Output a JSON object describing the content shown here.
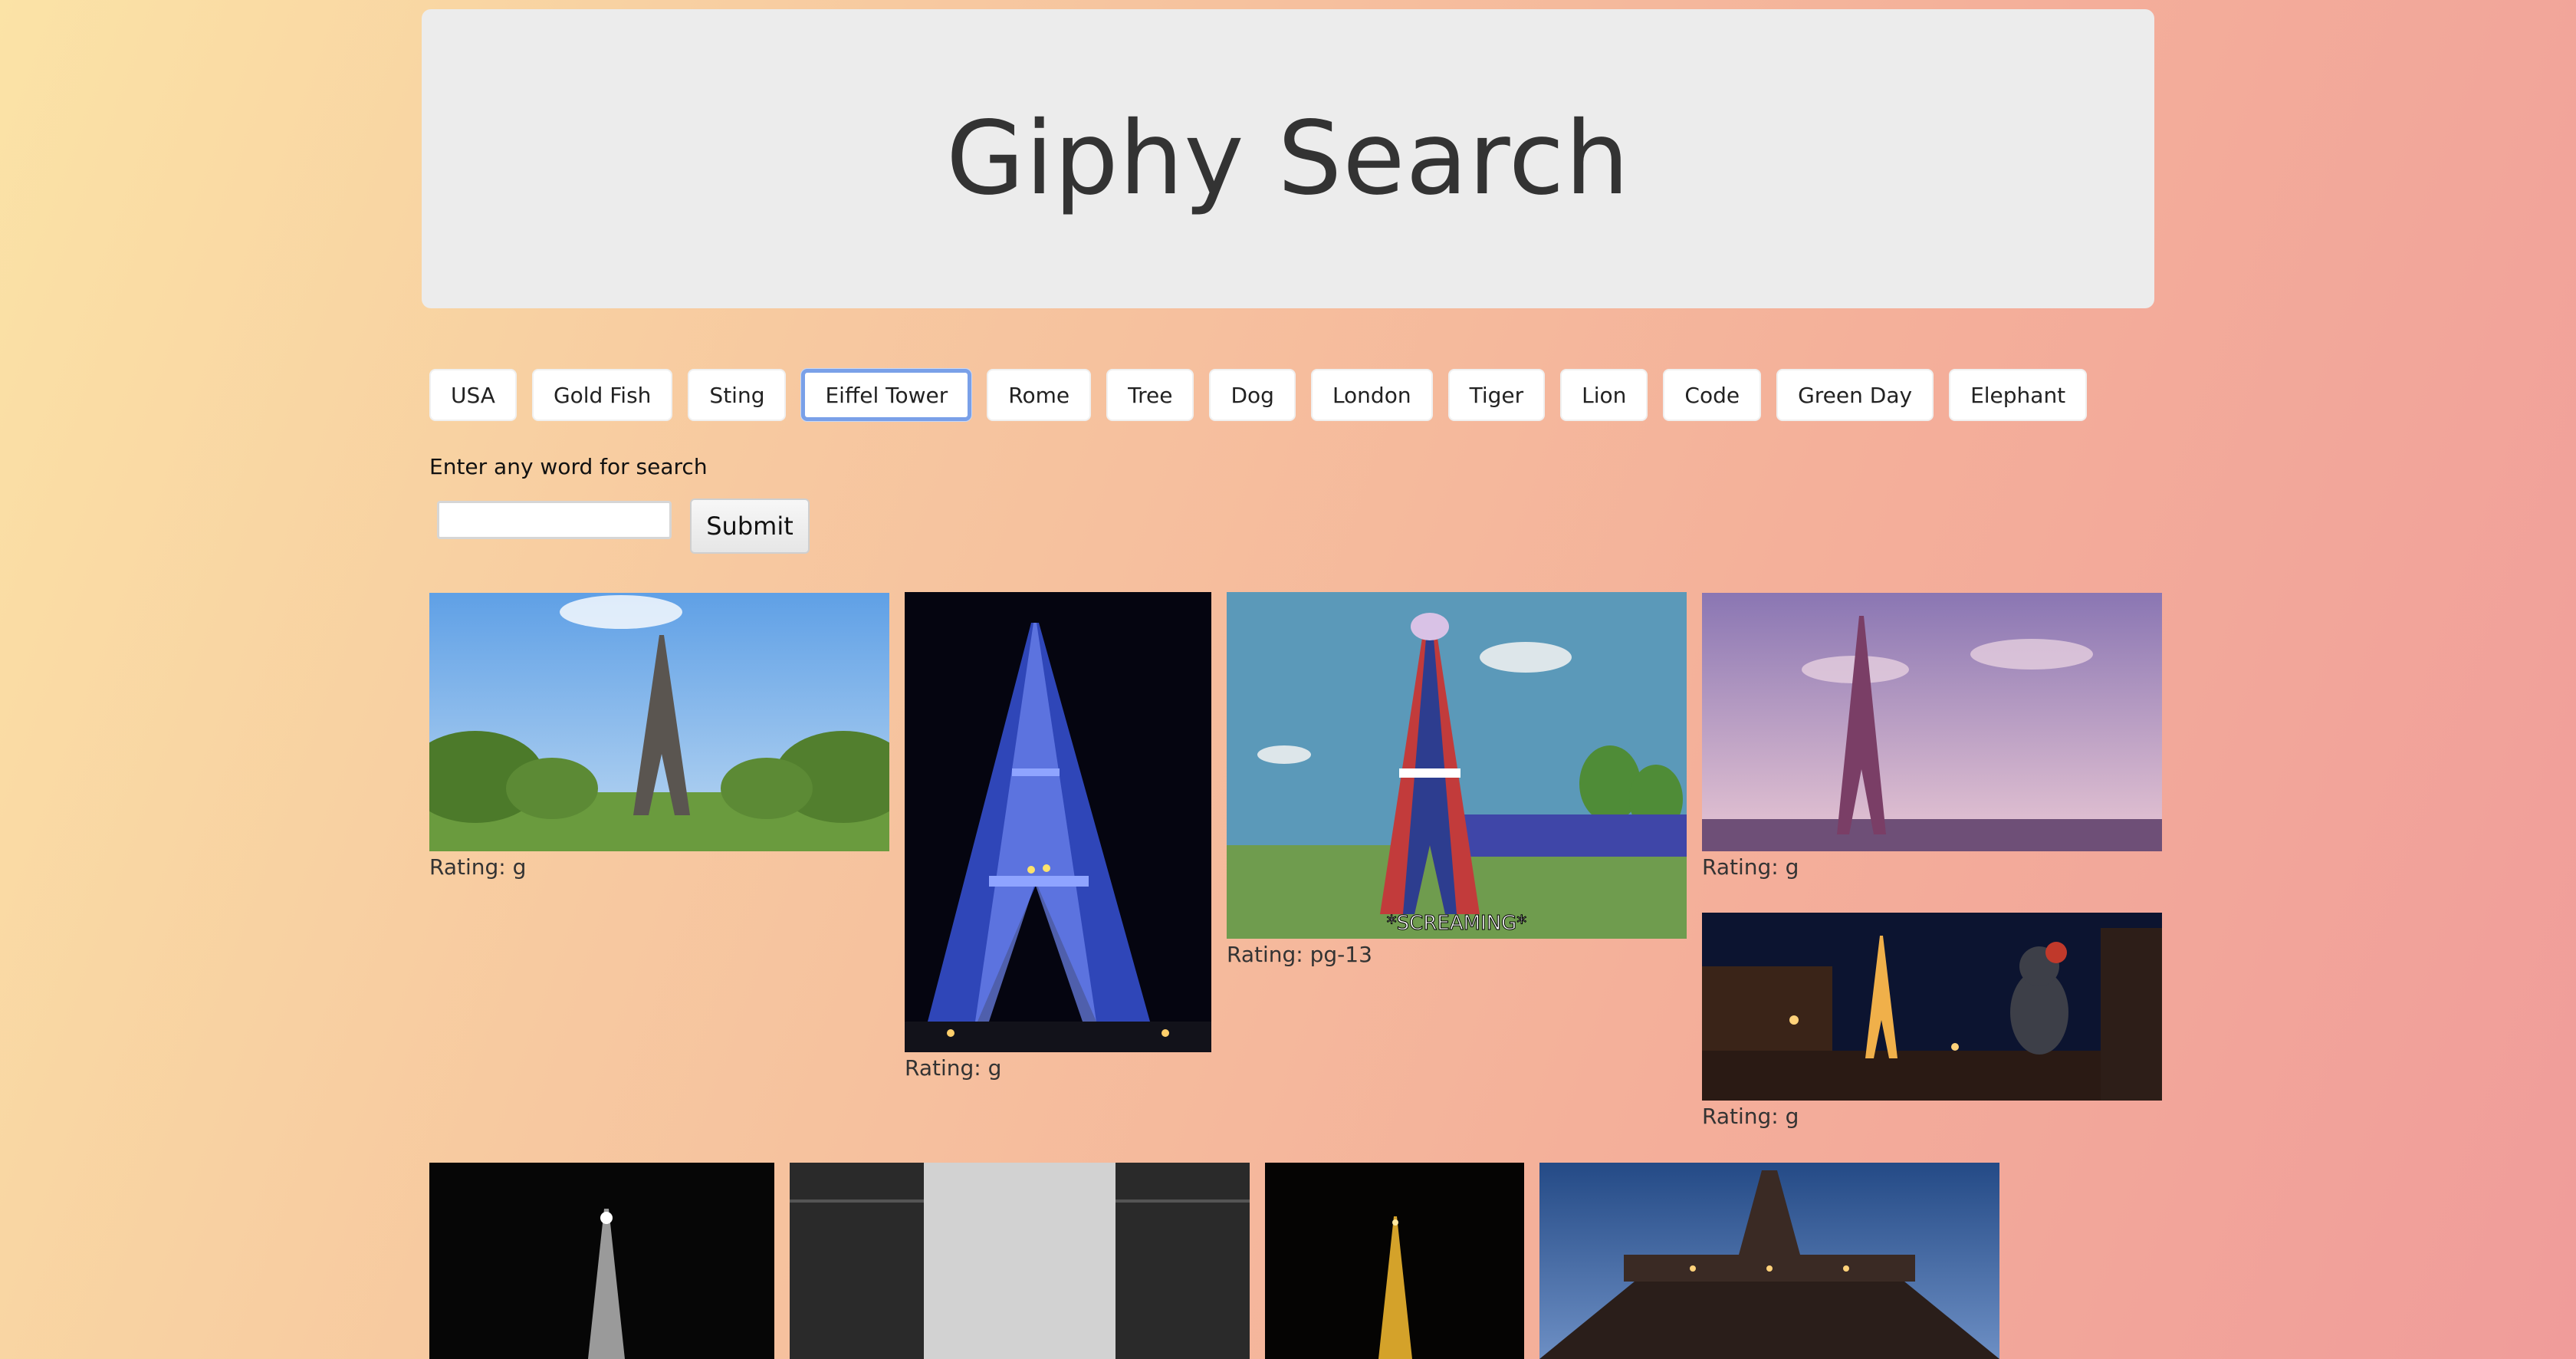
{
  "header": {
    "title": "Giphy Search"
  },
  "topics": [
    "USA",
    "Gold Fish",
    "Sting",
    "Eiffel Tower",
    "Rome",
    "Tree",
    "Dog",
    "London",
    "Tiger",
    "Lion",
    "Code",
    "Green Day",
    "Elephant"
  ],
  "active_topic": "Eiffel Tower",
  "search": {
    "label": "Enter any word for search",
    "value": "",
    "placeholder": "",
    "submit_label": "Submit"
  },
  "results": [
    {
      "rating": "Rating: g",
      "subject": "eiffel tower daytime park"
    },
    {
      "rating": "Rating: g",
      "subject": "eiffel tower night blue lights"
    },
    {
      "rating": "Rating: pg-13",
      "subject": "cartoon tower screaming",
      "caption": "*SCREAMING*"
    },
    {
      "rating": "Rating: g",
      "subject": "eiffel tower pink sky"
    },
    {
      "rating": "Rating: g",
      "subject": "rat overlooking paris at night"
    },
    {
      "rating": "",
      "subject": "eiffel tower night black and white"
    },
    {
      "rating": "",
      "subject": "grey static frame"
    },
    {
      "rating": "",
      "subject": "eiffel tower golden lights"
    },
    {
      "rating": "",
      "subject": "eiffel tower from below at dusk"
    }
  ],
  "colors": {
    "active_border": "#7aa0e8",
    "jumbotron_bg": "#ececec"
  }
}
